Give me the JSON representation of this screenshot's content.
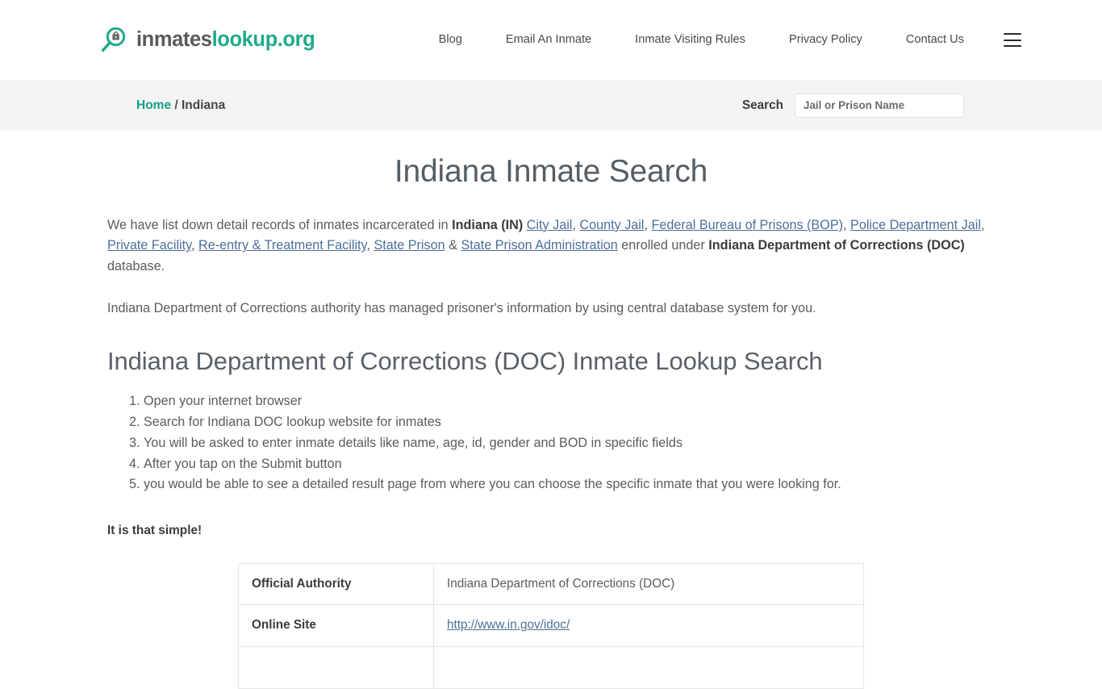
{
  "header": {
    "logo": {
      "icon": "magnifier-lock-icon",
      "text_dark": "inmates",
      "text_accent": "lookup.org",
      "accent_color": "#1faa8b",
      "dark_color": "#5a5a5a"
    },
    "nav": [
      {
        "label": "Blog"
      },
      {
        "label": "Email An Inmate"
      },
      {
        "label": "Inmate Visiting Rules"
      },
      {
        "label": "Privacy Policy"
      },
      {
        "label": "Contact Us"
      }
    ],
    "menu_toggle_icon": "hamburger-menu-icon"
  },
  "breadcrumb": {
    "home_label": "Home",
    "separator": "/",
    "current_label": "Indiana",
    "home_color": "#16a085"
  },
  "search": {
    "label": "Search",
    "placeholder": "Jail or Prison Name",
    "value": ""
  },
  "main": {
    "page_title": "Indiana Inmate Search",
    "intro": {
      "t1": "We have list down detail records of inmates incarcerated in ",
      "state_bold": "Indiana (IN)",
      "t2": " ",
      "links": [
        "City Jail",
        "County Jail",
        "Federal Bureau of Prisons (BOP)",
        "Police Department Jail",
        "Private Facility",
        "Re-entry & Treatment Facility",
        "State Prison",
        "State Prison Administration"
      ],
      "sep_comma": ", ",
      "sep_amp": " & ",
      "t3": " enrolled under ",
      "doc_bold": "Indiana Department of Corrections (DOC)",
      "t4": " database."
    },
    "paragraph_2": "Indiana Department of Corrections authority has managed prisoner's information by using central database system for you.",
    "section_heading": "Indiana Department of Corrections (DOC) Inmate Lookup Search",
    "steps": [
      "Open your internet browser",
      "Search for Indiana DOC lookup website for inmates",
      "You will be asked to enter inmate details like name, age, id, gender and BOD in specific fields",
      "After you tap on the Submit button",
      "you would be able to see a detailed result page from where you can choose the specific inmate that you were looking for."
    ],
    "simple_note": "It is that simple!",
    "info_table": {
      "rows": [
        {
          "key": "Official Authority",
          "value": "Indiana Department of Corrections (DOC)",
          "is_link": false
        },
        {
          "key": "Online Site",
          "value": "http://www.in.gov/idoc/",
          "is_link": true
        }
      ]
    }
  }
}
